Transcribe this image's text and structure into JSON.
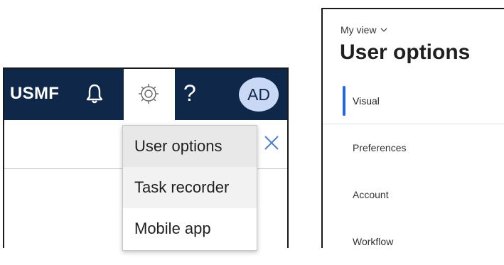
{
  "left": {
    "navbar": {
      "company": "USMF",
      "help_glyph": "?",
      "avatar_initials": "AD",
      "icons": [
        "bell-icon",
        "gear-icon",
        "help-icon"
      ]
    },
    "dropdown": {
      "items": [
        {
          "label": "User options",
          "state": "selected"
        },
        {
          "label": "Task recorder",
          "state": "hover"
        },
        {
          "label": "Mobile app",
          "state": "normal"
        }
      ]
    },
    "subbar": {
      "close_icon": "close-icon"
    }
  },
  "right": {
    "view_selector": "My view",
    "title": "User options",
    "nav": [
      {
        "label": "Visual",
        "active": true
      },
      {
        "label": "Preferences",
        "active": false
      },
      {
        "label": "Account",
        "active": false
      },
      {
        "label": "Workflow",
        "active": false
      }
    ]
  },
  "colors": {
    "navbar": "#0f2748",
    "avatar_bg": "#c9d8f4",
    "accent": "#2266e3"
  }
}
